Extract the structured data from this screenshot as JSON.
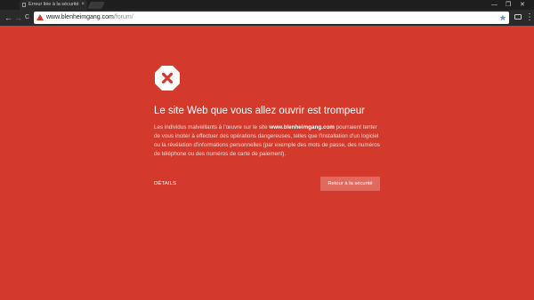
{
  "browser": {
    "tab_title": "Erreur liée à la sécurité",
    "tab_close": "×",
    "url_host": "www.blenheimgang.com",
    "url_path": "/forum/",
    "nav_back": "←",
    "nav_forward": "→",
    "nav_reload": "C",
    "star": "★",
    "menu": "⋮",
    "window_controls": [
      "—",
      "❐",
      "✕"
    ],
    "icons": {
      "tab": "page-icon",
      "security": "warning-triangle-icon",
      "bookmark": "star-icon",
      "cast": "cast-icon"
    }
  },
  "interstitial": {
    "icon": "error-x-icon",
    "heading": "Le site Web que vous allez ouvrir est trompeur",
    "desc_part1": "Les individus malveillants à l'œuvre sur le site ",
    "desc_site": "www.blenheimgang.com",
    "desc_part2": " pourraient tenter de vous inciter à effectuer des opérations dangereuses, telles que l'installation d'un logiciel ou la révélation d'informations personnelles (par exemple des mots de passe, des numéros de téléphone ou des numéros de carte de paiement).",
    "details_label": "DÉTAILS",
    "back_button": "Retour à la sécurité"
  },
  "colors": {
    "background": "#d33a2c",
    "button": "#e06a5f",
    "chrome_dark": "#2b2b2b"
  }
}
